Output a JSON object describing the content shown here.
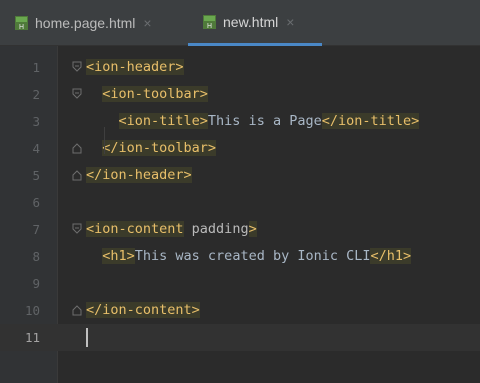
{
  "tabs": [
    {
      "label": "home.page.html",
      "close": "×",
      "icon": "html-file-icon",
      "active": false
    },
    {
      "label": "new.html",
      "close": "×",
      "icon": "html-file-icon",
      "active": true
    }
  ],
  "editor": {
    "lines": [
      {
        "num": "1",
        "parts": [
          [
            "tag",
            "<ion-header>"
          ]
        ]
      },
      {
        "num": "2",
        "parts": [
          [
            "txt",
            "  "
          ],
          [
            "tag",
            "<ion-toolbar>"
          ]
        ]
      },
      {
        "num": "3",
        "parts": [
          [
            "txt",
            "    "
          ],
          [
            "tag",
            "<ion-title>"
          ],
          [
            "txt",
            "This is a Page"
          ],
          [
            "tag",
            "</ion-title>"
          ]
        ]
      },
      {
        "num": "4",
        "parts": [
          [
            "txt",
            "  "
          ],
          [
            "tag",
            "</ion-toolbar>"
          ]
        ]
      },
      {
        "num": "5",
        "parts": [
          [
            "tag",
            "</ion-header>"
          ]
        ]
      },
      {
        "num": "6",
        "parts": []
      },
      {
        "num": "7",
        "parts": [
          [
            "tag",
            "<ion-content"
          ],
          [
            "attr",
            " padding"
          ],
          [
            "tag",
            ">"
          ]
        ]
      },
      {
        "num": "8",
        "parts": [
          [
            "txt",
            "  "
          ],
          [
            "tag",
            "<h1>"
          ],
          [
            "txt",
            "This was created by Ionic CLI"
          ],
          [
            "tag",
            "</h1>"
          ]
        ]
      },
      {
        "num": "9",
        "parts": []
      },
      {
        "num": "10",
        "parts": [
          [
            "tag",
            "</ion-content>"
          ]
        ]
      },
      {
        "num": "11",
        "parts": []
      }
    ],
    "current_line": "11"
  },
  "colors": {
    "tag": "#e8bf6a",
    "text": "#a9b7c6",
    "background": "#2b2b2b",
    "gutter": "#313335",
    "accent": "#4a88c7"
  }
}
